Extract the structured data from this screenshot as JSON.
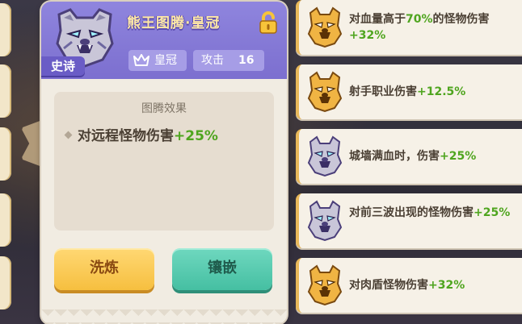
{
  "panel": {
    "title": "熊王图腾·皇冠",
    "rarity": "史诗",
    "type_label": "皇冠",
    "attack_label": "攻击",
    "attack_value": "16",
    "effect_title": "图腾效果",
    "effect_text": "对远程怪物伤害",
    "effect_bonus": "+25%",
    "refine_button": "洗炼",
    "inlay_button": "镶嵌",
    "colors": {
      "header": "#8f85de",
      "rarity": "#6a5cc6",
      "bonus_green": "#4fa51f",
      "refine": "#f6bf3f",
      "inlay": "#45bfa2"
    }
  },
  "list": [
    {
      "icon": "golden-bear-icon",
      "text": "对血量高于",
      "highlight": "70%",
      "text2": "的怪物伤害",
      "bonus": "+32%"
    },
    {
      "icon": "golden-bear-icon",
      "text": "射手职业伤害",
      "bonus": "+12.5%"
    },
    {
      "icon": "silver-bear-icon",
      "text": "城墙满血时，伤害",
      "bonus": "+25%"
    },
    {
      "icon": "silver-bear-icon",
      "text": "对前三波出现的怪物伤害",
      "bonus": "+25%"
    },
    {
      "icon": "golden-bear-icon",
      "text": "对肉盾怪物伤害",
      "bonus": "+32%"
    }
  ]
}
